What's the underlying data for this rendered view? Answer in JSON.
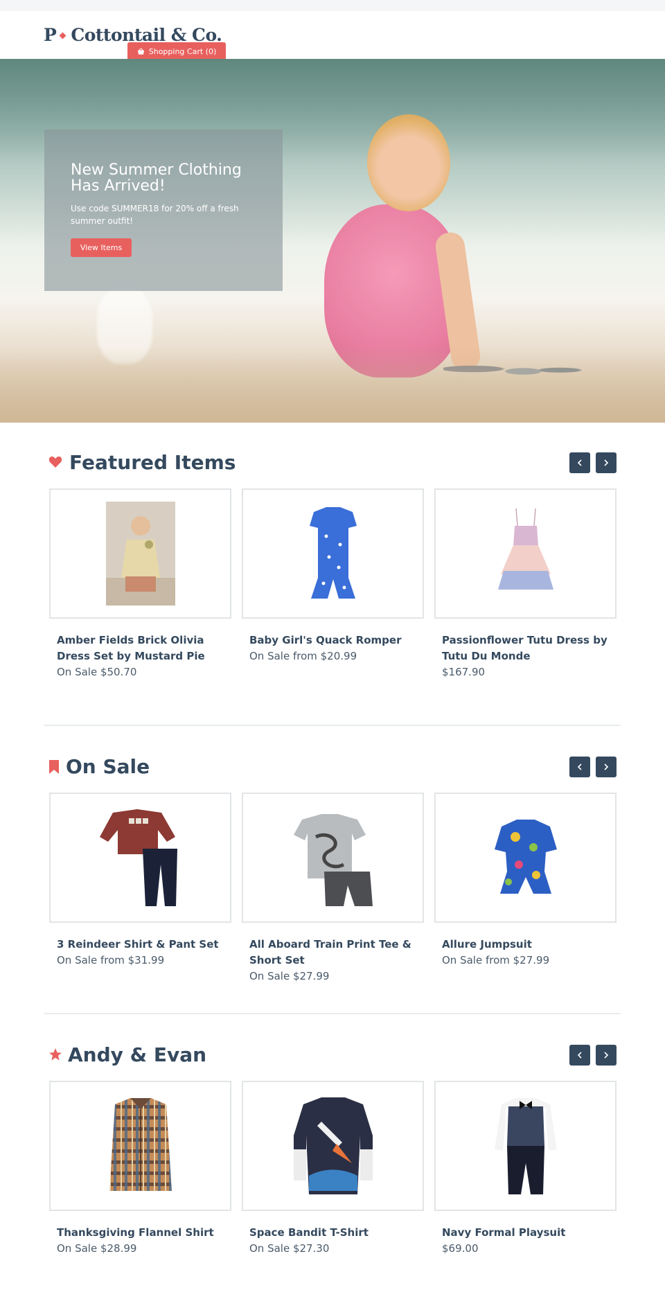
{
  "brand": {
    "name_initial": "P",
    "name_rest": "Cottontail & Co."
  },
  "cart": {
    "label": "Shopping Cart (0)"
  },
  "hero": {
    "title": "New Summer Clothing Has Arrived!",
    "subtitle": "Use code SUMMER18 for 20% off a fresh summer outfit!",
    "button": "View Items"
  },
  "sections": [
    {
      "title": "Featured Items",
      "icon": "heart-icon",
      "items": [
        {
          "name": "Amber Fields Brick Olivia Dress Set by Mustard Pie",
          "price": "On Sale $50.70"
        },
        {
          "name": "Baby Girl's Quack Romper",
          "price": "On Sale from $20.99"
        },
        {
          "name": "Passionflower Tutu Dress by Tutu Du Monde",
          "price": "$167.90"
        }
      ]
    },
    {
      "title": "On Sale",
      "icon": "bookmark-icon",
      "items": [
        {
          "name": "3 Reindeer Shirt & Pant Set",
          "price": "On Sale from $31.99"
        },
        {
          "name": "All Aboard Train Print Tee & Short Set",
          "price": "On Sale $27.99"
        },
        {
          "name": "Allure Jumpsuit",
          "price": "On Sale from $27.99"
        }
      ]
    },
    {
      "title": "Andy & Evan",
      "icon": "star-icon",
      "items": [
        {
          "name": "Thanksgiving Flannel Shirt",
          "price": "On Sale $28.99"
        },
        {
          "name": "Space Bandit T-Shirt",
          "price": "On Sale $27.30"
        },
        {
          "name": "Navy Formal Playsuit",
          "price": "$69.00"
        }
      ]
    }
  ],
  "colors": {
    "accent": "#e8605e",
    "navy": "#34495e",
    "border": "#e2e4e6"
  }
}
